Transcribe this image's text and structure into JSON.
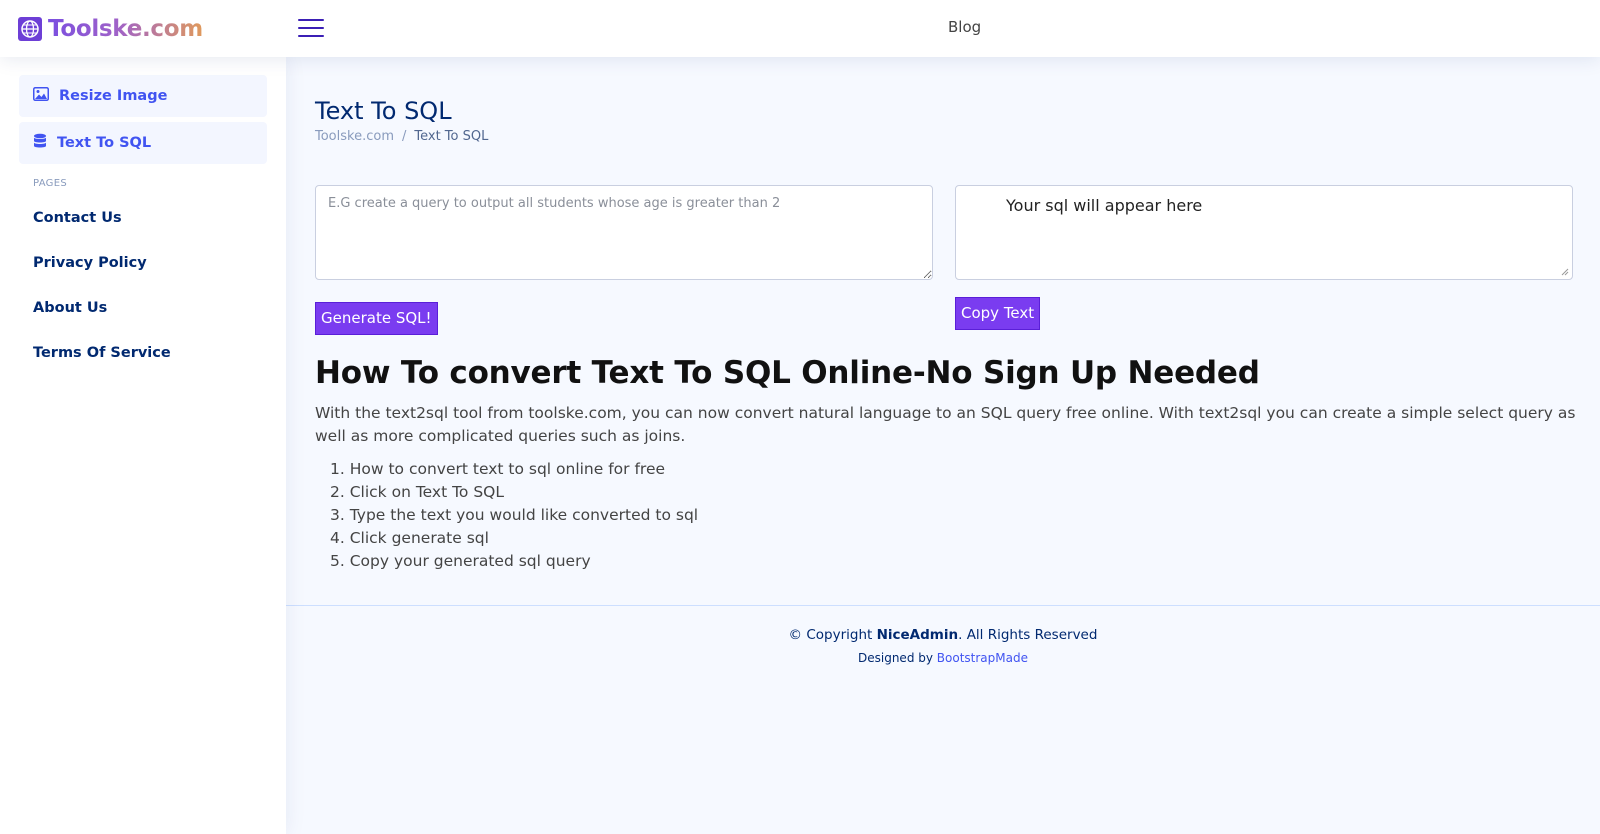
{
  "header": {
    "logo_text": "Toolske.com",
    "nav_blog": "Blog"
  },
  "sidebar": {
    "items": [
      {
        "label": "Resize Image",
        "icon": "image-icon"
      },
      {
        "label": "Text To SQL",
        "icon": "database-icon"
      }
    ],
    "section_heading": "PAGES",
    "pages": [
      {
        "label": "Contact Us"
      },
      {
        "label": "Privacy Policy"
      },
      {
        "label": "About Us"
      },
      {
        "label": "Terms Of Service"
      }
    ]
  },
  "main": {
    "title": "Text To SQL",
    "breadcrumb": {
      "home": "Toolske.com",
      "separator": "/",
      "current": "Text To SQL"
    },
    "input_placeholder": "E.G create a query to output all students whose age is greater than 2",
    "output_text": "Your sql will appear here",
    "generate_button": "Generate SQL!",
    "copy_button": "Copy Text",
    "article_title": "How To convert Text To SQL Online-No Sign Up Needed",
    "article_paragraph": "With the text2sql tool from toolske.com, you can now convert natural language to an SQL query free online. With text2sql you can create a simple select query as well as more complicated queries such as joins.",
    "steps": [
      "How to convert text to sql online for free",
      "Click on Text To SQL",
      "Type the text you would like converted to sql",
      "Click generate sql",
      "Copy your generated sql query"
    ]
  },
  "footer": {
    "copyright_prefix": "© Copyright ",
    "copyright_brand": "NiceAdmin",
    "copyright_suffix": ". All Rights Reserved",
    "designed_by": "Designed by ",
    "designer": "BootstrapMade"
  },
  "colors": {
    "accent_button": "#7a3cf0",
    "sidebar_active_text": "#4154f1",
    "nav_text": "#012970",
    "page_background": "#f6f9ff"
  }
}
